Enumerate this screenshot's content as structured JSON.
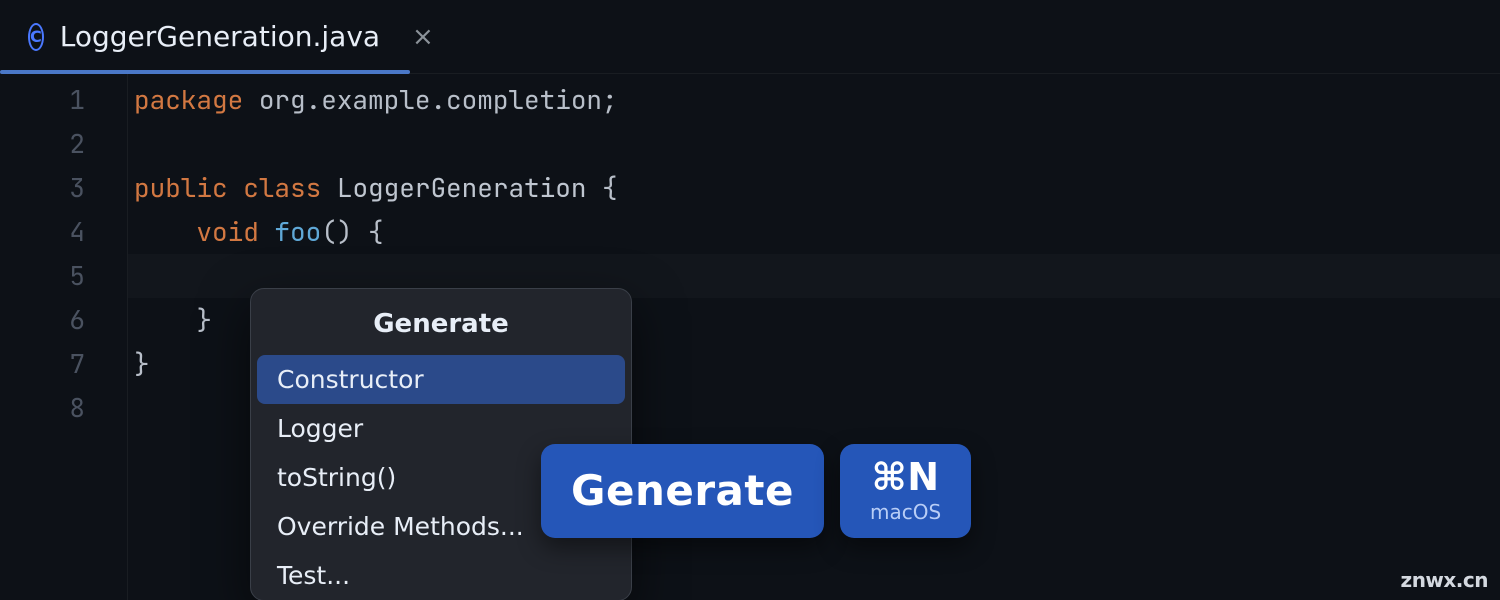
{
  "tab": {
    "file_icon_letter": "C",
    "filename": "LoggerGeneration.java"
  },
  "gutter": [
    "1",
    "2",
    "3",
    "4",
    "5",
    "6",
    "7",
    "8"
  ],
  "code": {
    "package_kw": "package",
    "package_name": "org.example.completion",
    "public_kw": "public",
    "class_kw": "class",
    "class_name": "LoggerGeneration",
    "void_kw": "void",
    "method_name": "foo"
  },
  "popup": {
    "title": "Generate",
    "items": [
      "Constructor",
      "Logger",
      "toString()",
      "Override Methods...",
      "Test..."
    ],
    "selected_index": 0
  },
  "badges": {
    "generate": "Generate",
    "shortcut": "⌘N",
    "platform": "macOS"
  },
  "watermark": "znwx.cn",
  "colors": {
    "accent": "#2556b8",
    "selection": "#2b4a8a",
    "keyword": "#d27842",
    "function": "#5fa8d7"
  }
}
